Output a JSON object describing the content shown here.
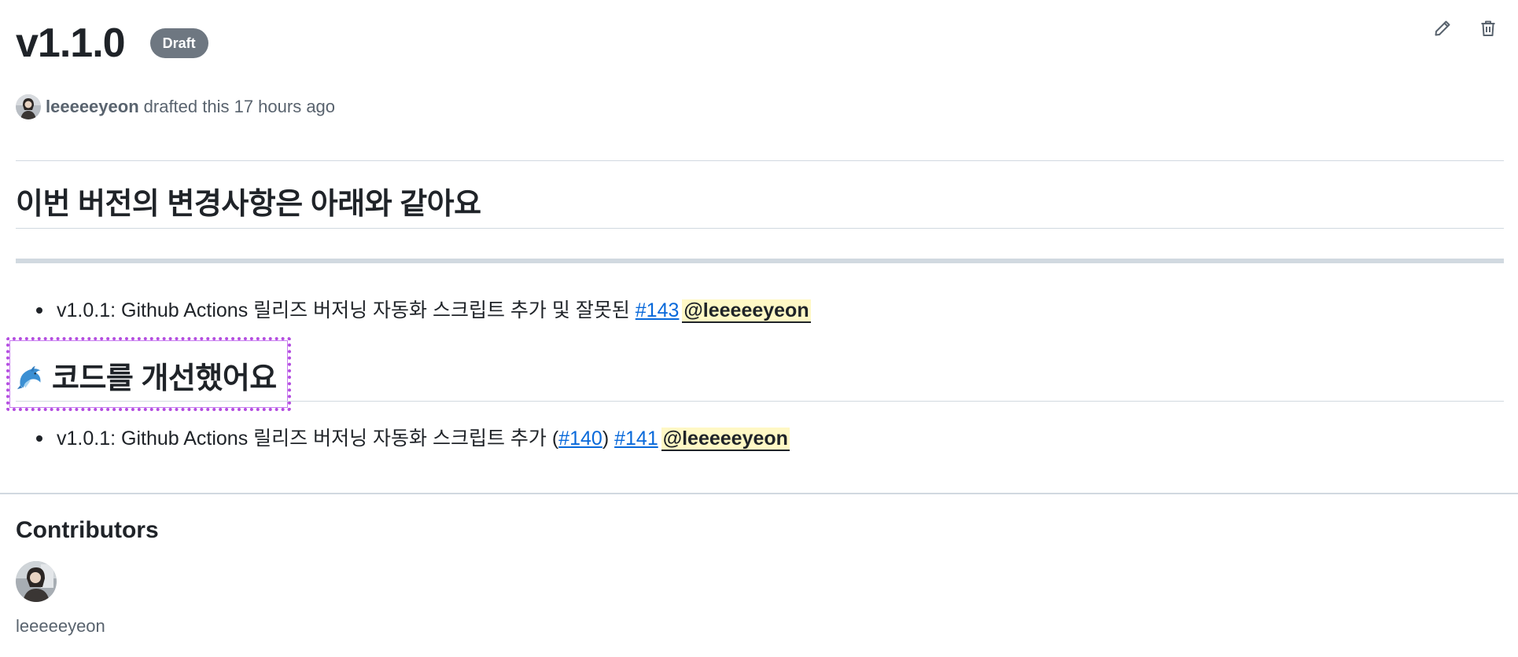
{
  "release": {
    "title": "v1.1.0",
    "badge": "Draft",
    "author": "leeeeeyeon",
    "meta_text": "drafted this 17 hours ago"
  },
  "actions": {
    "edit_icon": "pencil-icon",
    "delete_icon": "trash-icon"
  },
  "body": {
    "heading1": "이번 버전의 변경사항은 아래와 같아요",
    "item1": {
      "text": "v1.0.1: Github Actions 릴리즈 버저닝 자동화 스크립트 추가 및 잘못된 ",
      "link1": "#143",
      "mention": "@leeeeeyeon"
    },
    "heading2": {
      "emoji": "🐬",
      "text": "코드를 개선했어요"
    },
    "item2": {
      "text": "v1.0.1: Github Actions 릴리즈 버저닝 자동화 스크립트 추가 (",
      "link1": "#140",
      "after_link1": ")",
      "link2": "#141",
      "mention": "@leeeeeyeon"
    }
  },
  "contributors": {
    "title": "Contributors",
    "items": [
      {
        "name": "leeeeeyeon"
      }
    ]
  },
  "colors": {
    "badge_bg": "#6e7781",
    "link": "#0969da",
    "mention_bg": "#fff8c5",
    "highlight_border": "#b44de0"
  }
}
